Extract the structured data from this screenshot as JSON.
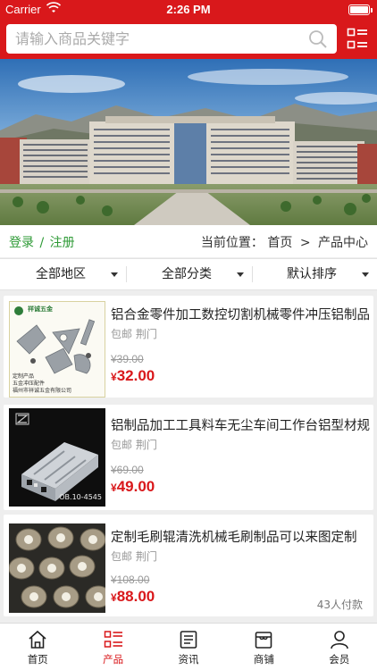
{
  "status_bar": {
    "carrier": "Carrier",
    "time": "2:26 PM"
  },
  "search": {
    "placeholder": "请输入商品关键字",
    "search_icon": "search-icon",
    "menu_icon": "grid-menu-icon"
  },
  "breadcrumb_bar": {
    "login": "登录",
    "separator": "/",
    "register": "注册",
    "location_label": "当前位置：",
    "home": "首页",
    "arrow": ">",
    "current": "产品中心"
  },
  "filters": [
    {
      "label": "全部地区"
    },
    {
      "label": "全部分类"
    },
    {
      "label": "默认排序"
    }
  ],
  "products": [
    {
      "name": "铝合金零件加工数控切割机械零件冲压铝制品",
      "location": "包邮  荆门",
      "old_price": "¥39.00",
      "price_symbol": "¥",
      "price": "32.00",
      "sold": "",
      "thumb_text": {
        "brand": "祥诚五金",
        "line1": "定制产品",
        "line2": "五金冲压配件",
        "line3": "福州市祥诚五金有限公司"
      }
    },
    {
      "name": "铝制品加工工具料车无尘车间工作台铝型材规",
      "location": "包邮  荆门",
      "old_price": "¥69.00",
      "price_symbol": "¥",
      "price": "49.00",
      "sold": "",
      "thumb_text": {
        "model": "OB.10-4545"
      }
    },
    {
      "name": "定制毛刷辊清洗机械毛刷制品可以来图定制",
      "location": "包邮  荆门",
      "old_price": "¥108.00",
      "price_symbol": "¥",
      "price": "88.00",
      "sold": "43人付款"
    }
  ],
  "tabs": [
    {
      "label": "首页",
      "icon": "home-icon",
      "active": false
    },
    {
      "label": "产品",
      "icon": "list-icon",
      "active": true
    },
    {
      "label": "资讯",
      "icon": "news-icon",
      "active": false
    },
    {
      "label": "商铺",
      "icon": "shop-icon",
      "active": false
    },
    {
      "label": "会员",
      "icon": "user-icon",
      "active": false
    }
  ],
  "colors": {
    "brand_red": "#d9181b",
    "login_green": "#2e9a36",
    "price_red": "#d9181b"
  }
}
